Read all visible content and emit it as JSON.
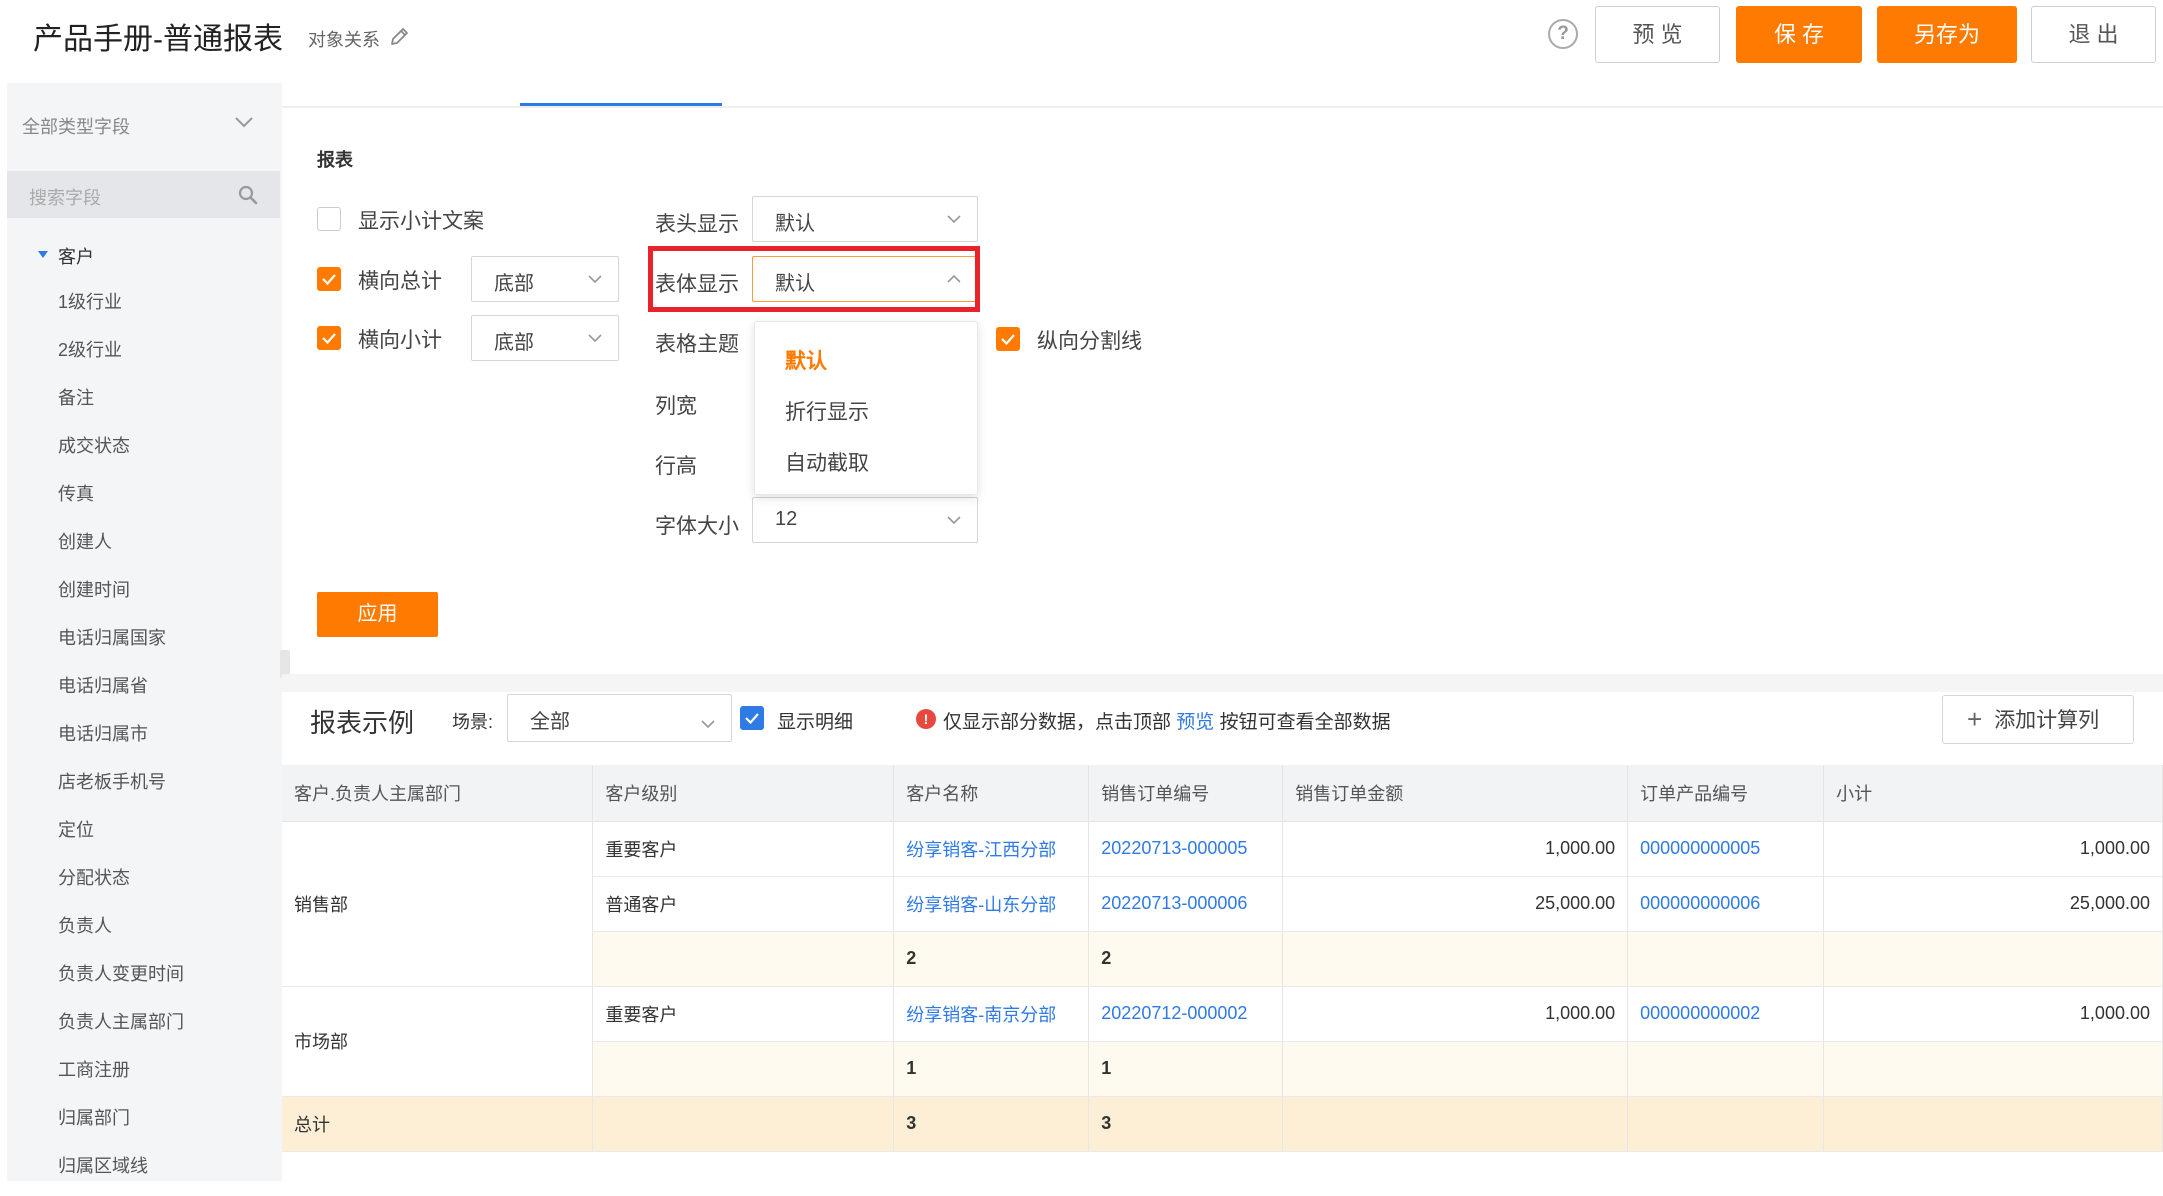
{
  "header": {
    "title": "产品手册-普通报表",
    "object_relation": "对象关系",
    "help_symbol": "?",
    "buttons": {
      "preview": "预 览",
      "save": "保 存",
      "save_as": "另存为",
      "exit": "退 出"
    },
    "accent_color": "#ff7a00"
  },
  "sidebar": {
    "type_filter": "全部类型字段",
    "search_placeholder": "搜索字段",
    "root": "客户",
    "fields": [
      "1级行业",
      "2级行业",
      "备注",
      "成交状态",
      "传真",
      "创建人",
      "创建时间",
      "电话归属国家",
      "电话归属省",
      "电话归属市",
      "店老板手机号",
      "定位",
      "分配状态",
      "负责人",
      "负责人变更时间",
      "负责人主属部门",
      "工商注册",
      "归属部门",
      "归属区域线"
    ]
  },
  "settings": {
    "section_title": "报表",
    "show_subtotal_text": {
      "label": "显示小计文案",
      "checked": false
    },
    "horizontal_total": {
      "label": "横向总计",
      "checked": true,
      "value": "底部"
    },
    "horizontal_subtotal": {
      "label": "横向小计",
      "checked": true,
      "value": "底部"
    },
    "header_display": {
      "label": "表头显示",
      "value": "默认"
    },
    "body_display": {
      "label": "表体显示",
      "value": "默认"
    },
    "table_theme": {
      "label": "表格主题"
    },
    "column_width": {
      "label": "列宽"
    },
    "row_height": {
      "label": "行高"
    },
    "font_size": {
      "label": "字体大小",
      "value": "12"
    },
    "vertical_divider": {
      "label": "纵向分割线",
      "checked": true
    },
    "dropdown_options": [
      "默认",
      "折行显示",
      "自动截取"
    ],
    "apply_label": "应用"
  },
  "report": {
    "title": "报表示例",
    "scene_label": "场景:",
    "scene_value": "全部",
    "show_detail": {
      "label": "显示明细",
      "checked": true
    },
    "warning_icon": "!",
    "notice_prefix": "仅显示部分数据，点击顶部 ",
    "notice_link": "预览",
    "notice_suffix": " 按钮可查看全部数据",
    "add_column_icon": "+",
    "add_column_label": "添加计算列",
    "columns": [
      "客户.负责人主属部门",
      "客户级别",
      "客户名称",
      "销售订单编号",
      "销售订单金额",
      "订单产品编号",
      "小计"
    ],
    "groups": {
      "sales": "销售部",
      "market": "市场部",
      "total": "总计"
    },
    "rows": [
      {
        "level": "重要客户",
        "customer": "纷享销客-江西分部",
        "order_no": "20220713-000005",
        "amount": "1,000.00",
        "product_no": "000000000005",
        "subtotal": "1,000.00"
      },
      {
        "level": "普通客户",
        "customer": "纷享销客-山东分部",
        "order_no": "20220713-000006",
        "amount": "25,000.00",
        "product_no": "000000000006",
        "subtotal": "25,000.00"
      },
      {
        "customer": "2",
        "order_no": "2"
      },
      {
        "level": "重要客户",
        "customer": "纷享销客-南京分部",
        "order_no": "20220712-000002",
        "amount": "1,000.00",
        "product_no": "000000000002",
        "subtotal": "1,000.00"
      },
      {
        "customer": "1",
        "order_no": "1"
      },
      {
        "customer": "3",
        "order_no": "3"
      }
    ]
  }
}
